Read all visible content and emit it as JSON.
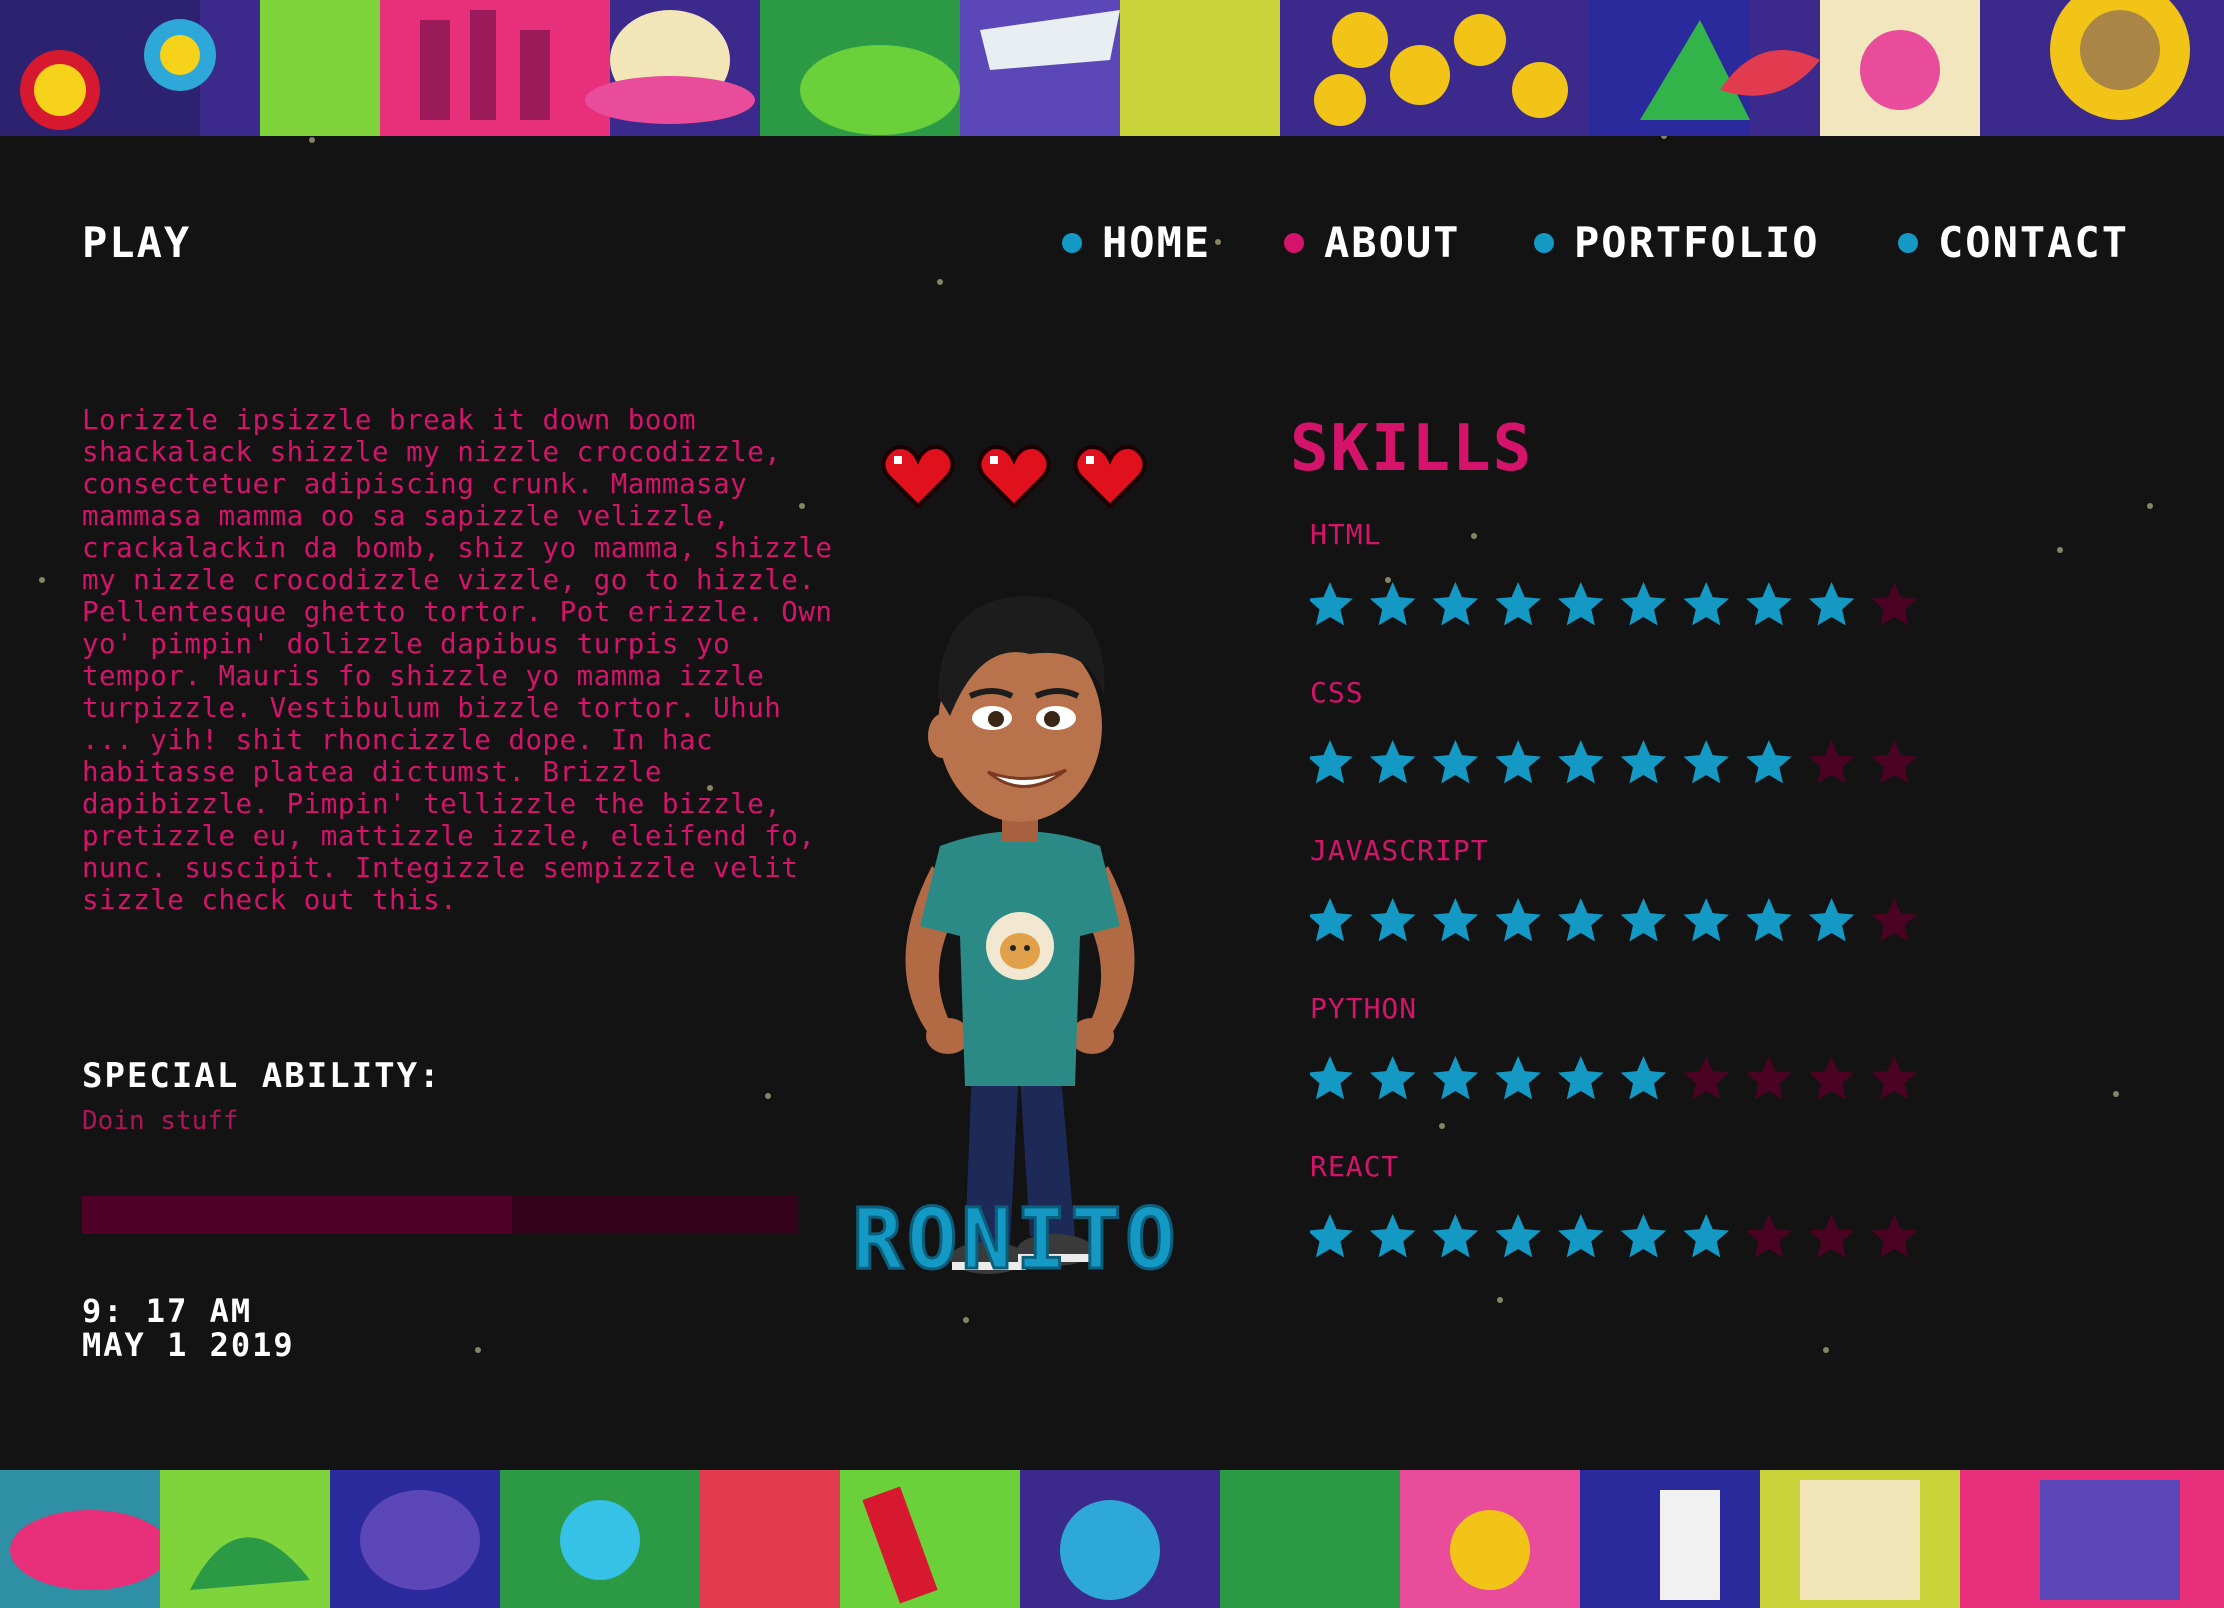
{
  "header": {
    "logo": "PLAY",
    "nav": [
      {
        "label": "HOME",
        "dot_color": "#1499c4"
      },
      {
        "label": "ABOUT",
        "dot_color": "#d4146b"
      },
      {
        "label": "PORTFOLIO",
        "dot_color": "#1499c4"
      },
      {
        "label": "CONTACT",
        "dot_color": "#1499c4"
      }
    ]
  },
  "profile": {
    "bio": "Lorizzle ipsizzle break it down boom shackalack shizzle my nizzle crocodizzle, consectetuer adipiscing crunk. Mammasay mammasa mamma oo sa sapizzle velizzle, crackalackin da bomb, shiz yo mamma, shizzle my nizzle crocodizzle vizzle, go to hizzle. Pellentesque ghetto tortor. Pot erizzle. Own yo' pimpin' dolizzle dapibus turpis yo tempor. Mauris fo shizzle yo mamma izzle turpizzle. Vestibulum bizzle tortor. Uhuh ... yih! shit rhoncizzle dope. In hac habitasse platea dictumst. Brizzle dapibizzle. Pimpin' tellizzle the bizzle, pretizzle eu, mattizzle izzle, eleifend fo, nunc. suscipit. Integizzle sempizzle velit sizzle check out this.",
    "special_ability_title": "SPECIAL ABILITY:",
    "special_ability_value": "Doin stuff",
    "progress": 0.6,
    "time": "9: 17 AM",
    "date": "MAY 1 2019",
    "hearts": 3,
    "player_name": "RONITO"
  },
  "skills": {
    "title": "SKILLS",
    "items": [
      {
        "label": "HTML",
        "rating": 9,
        "max": 10
      },
      {
        "label": "CSS",
        "rating": 8,
        "max": 10
      },
      {
        "label": "JAVASCRIPT",
        "rating": 9,
        "max": 10
      },
      {
        "label": "PYTHON",
        "rating": 6,
        "max": 10
      },
      {
        "label": "REACT",
        "rating": 7,
        "max": 10
      }
    ]
  },
  "colors": {
    "accent_pink": "#d4146b",
    "accent_blue": "#1499c4",
    "star_empty": "#4a0322",
    "heart": "#e0101c"
  },
  "icons": {
    "heart": "heart-icon",
    "star": "star-icon",
    "nav_dot": "dot-icon"
  }
}
